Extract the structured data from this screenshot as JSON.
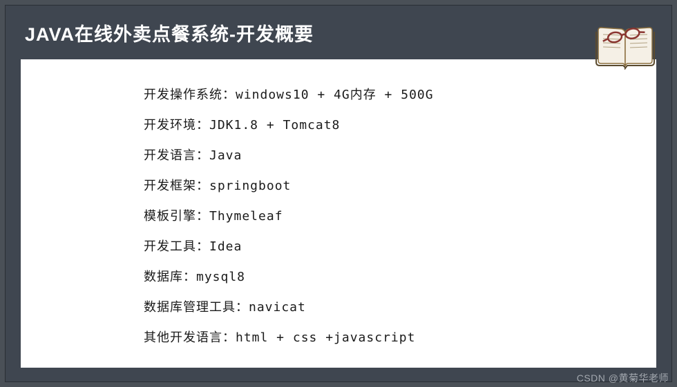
{
  "header": {
    "title": "JAVA在线外卖点餐系统-开发概要"
  },
  "content": {
    "lines": [
      "开发操作系统：windows10 + 4G内存 + 500G",
      "开发环境：JDK1.8 + Tomcat8",
      "开发语言：Java",
      "开发框架：springboot",
      "模板引擎：Thymeleaf",
      "开发工具：Idea",
      "数据库：mysql8",
      "数据库管理工具：navicat",
      "其他开发语言：html + css +javascript"
    ]
  },
  "watermark": "CSDN @黄菊华老师"
}
